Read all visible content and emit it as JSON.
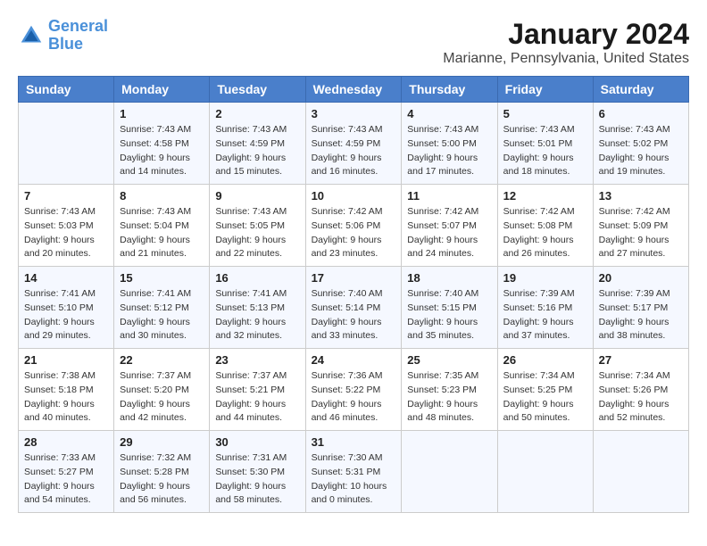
{
  "logo": {
    "line1": "General",
    "line2": "Blue"
  },
  "title": "January 2024",
  "location": "Marianne, Pennsylvania, United States",
  "headers": [
    "Sunday",
    "Monday",
    "Tuesday",
    "Wednesday",
    "Thursday",
    "Friday",
    "Saturday"
  ],
  "weeks": [
    [
      {
        "day": "",
        "sunrise": "",
        "sunset": "",
        "daylight": ""
      },
      {
        "day": "1",
        "sunrise": "Sunrise: 7:43 AM",
        "sunset": "Sunset: 4:58 PM",
        "daylight": "Daylight: 9 hours and 14 minutes."
      },
      {
        "day": "2",
        "sunrise": "Sunrise: 7:43 AM",
        "sunset": "Sunset: 4:59 PM",
        "daylight": "Daylight: 9 hours and 15 minutes."
      },
      {
        "day": "3",
        "sunrise": "Sunrise: 7:43 AM",
        "sunset": "Sunset: 4:59 PM",
        "daylight": "Daylight: 9 hours and 16 minutes."
      },
      {
        "day": "4",
        "sunrise": "Sunrise: 7:43 AM",
        "sunset": "Sunset: 5:00 PM",
        "daylight": "Daylight: 9 hours and 17 minutes."
      },
      {
        "day": "5",
        "sunrise": "Sunrise: 7:43 AM",
        "sunset": "Sunset: 5:01 PM",
        "daylight": "Daylight: 9 hours and 18 minutes."
      },
      {
        "day": "6",
        "sunrise": "Sunrise: 7:43 AM",
        "sunset": "Sunset: 5:02 PM",
        "daylight": "Daylight: 9 hours and 19 minutes."
      }
    ],
    [
      {
        "day": "7",
        "sunrise": "Sunrise: 7:43 AM",
        "sunset": "Sunset: 5:03 PM",
        "daylight": "Daylight: 9 hours and 20 minutes."
      },
      {
        "day": "8",
        "sunrise": "Sunrise: 7:43 AM",
        "sunset": "Sunset: 5:04 PM",
        "daylight": "Daylight: 9 hours and 21 minutes."
      },
      {
        "day": "9",
        "sunrise": "Sunrise: 7:43 AM",
        "sunset": "Sunset: 5:05 PM",
        "daylight": "Daylight: 9 hours and 22 minutes."
      },
      {
        "day": "10",
        "sunrise": "Sunrise: 7:42 AM",
        "sunset": "Sunset: 5:06 PM",
        "daylight": "Daylight: 9 hours and 23 minutes."
      },
      {
        "day": "11",
        "sunrise": "Sunrise: 7:42 AM",
        "sunset": "Sunset: 5:07 PM",
        "daylight": "Daylight: 9 hours and 24 minutes."
      },
      {
        "day": "12",
        "sunrise": "Sunrise: 7:42 AM",
        "sunset": "Sunset: 5:08 PM",
        "daylight": "Daylight: 9 hours and 26 minutes."
      },
      {
        "day": "13",
        "sunrise": "Sunrise: 7:42 AM",
        "sunset": "Sunset: 5:09 PM",
        "daylight": "Daylight: 9 hours and 27 minutes."
      }
    ],
    [
      {
        "day": "14",
        "sunrise": "Sunrise: 7:41 AM",
        "sunset": "Sunset: 5:10 PM",
        "daylight": "Daylight: 9 hours and 29 minutes."
      },
      {
        "day": "15",
        "sunrise": "Sunrise: 7:41 AM",
        "sunset": "Sunset: 5:12 PM",
        "daylight": "Daylight: 9 hours and 30 minutes."
      },
      {
        "day": "16",
        "sunrise": "Sunrise: 7:41 AM",
        "sunset": "Sunset: 5:13 PM",
        "daylight": "Daylight: 9 hours and 32 minutes."
      },
      {
        "day": "17",
        "sunrise": "Sunrise: 7:40 AM",
        "sunset": "Sunset: 5:14 PM",
        "daylight": "Daylight: 9 hours and 33 minutes."
      },
      {
        "day": "18",
        "sunrise": "Sunrise: 7:40 AM",
        "sunset": "Sunset: 5:15 PM",
        "daylight": "Daylight: 9 hours and 35 minutes."
      },
      {
        "day": "19",
        "sunrise": "Sunrise: 7:39 AM",
        "sunset": "Sunset: 5:16 PM",
        "daylight": "Daylight: 9 hours and 37 minutes."
      },
      {
        "day": "20",
        "sunrise": "Sunrise: 7:39 AM",
        "sunset": "Sunset: 5:17 PM",
        "daylight": "Daylight: 9 hours and 38 minutes."
      }
    ],
    [
      {
        "day": "21",
        "sunrise": "Sunrise: 7:38 AM",
        "sunset": "Sunset: 5:18 PM",
        "daylight": "Daylight: 9 hours and 40 minutes."
      },
      {
        "day": "22",
        "sunrise": "Sunrise: 7:37 AM",
        "sunset": "Sunset: 5:20 PM",
        "daylight": "Daylight: 9 hours and 42 minutes."
      },
      {
        "day": "23",
        "sunrise": "Sunrise: 7:37 AM",
        "sunset": "Sunset: 5:21 PM",
        "daylight": "Daylight: 9 hours and 44 minutes."
      },
      {
        "day": "24",
        "sunrise": "Sunrise: 7:36 AM",
        "sunset": "Sunset: 5:22 PM",
        "daylight": "Daylight: 9 hours and 46 minutes."
      },
      {
        "day": "25",
        "sunrise": "Sunrise: 7:35 AM",
        "sunset": "Sunset: 5:23 PM",
        "daylight": "Daylight: 9 hours and 48 minutes."
      },
      {
        "day": "26",
        "sunrise": "Sunrise: 7:34 AM",
        "sunset": "Sunset: 5:25 PM",
        "daylight": "Daylight: 9 hours and 50 minutes."
      },
      {
        "day": "27",
        "sunrise": "Sunrise: 7:34 AM",
        "sunset": "Sunset: 5:26 PM",
        "daylight": "Daylight: 9 hours and 52 minutes."
      }
    ],
    [
      {
        "day": "28",
        "sunrise": "Sunrise: 7:33 AM",
        "sunset": "Sunset: 5:27 PM",
        "daylight": "Daylight: 9 hours and 54 minutes."
      },
      {
        "day": "29",
        "sunrise": "Sunrise: 7:32 AM",
        "sunset": "Sunset: 5:28 PM",
        "daylight": "Daylight: 9 hours and 56 minutes."
      },
      {
        "day": "30",
        "sunrise": "Sunrise: 7:31 AM",
        "sunset": "Sunset: 5:30 PM",
        "daylight": "Daylight: 9 hours and 58 minutes."
      },
      {
        "day": "31",
        "sunrise": "Sunrise: 7:30 AM",
        "sunset": "Sunset: 5:31 PM",
        "daylight": "Daylight: 10 hours and 0 minutes."
      },
      {
        "day": "",
        "sunrise": "",
        "sunset": "",
        "daylight": ""
      },
      {
        "day": "",
        "sunrise": "",
        "sunset": "",
        "daylight": ""
      },
      {
        "day": "",
        "sunrise": "",
        "sunset": "",
        "daylight": ""
      }
    ]
  ]
}
